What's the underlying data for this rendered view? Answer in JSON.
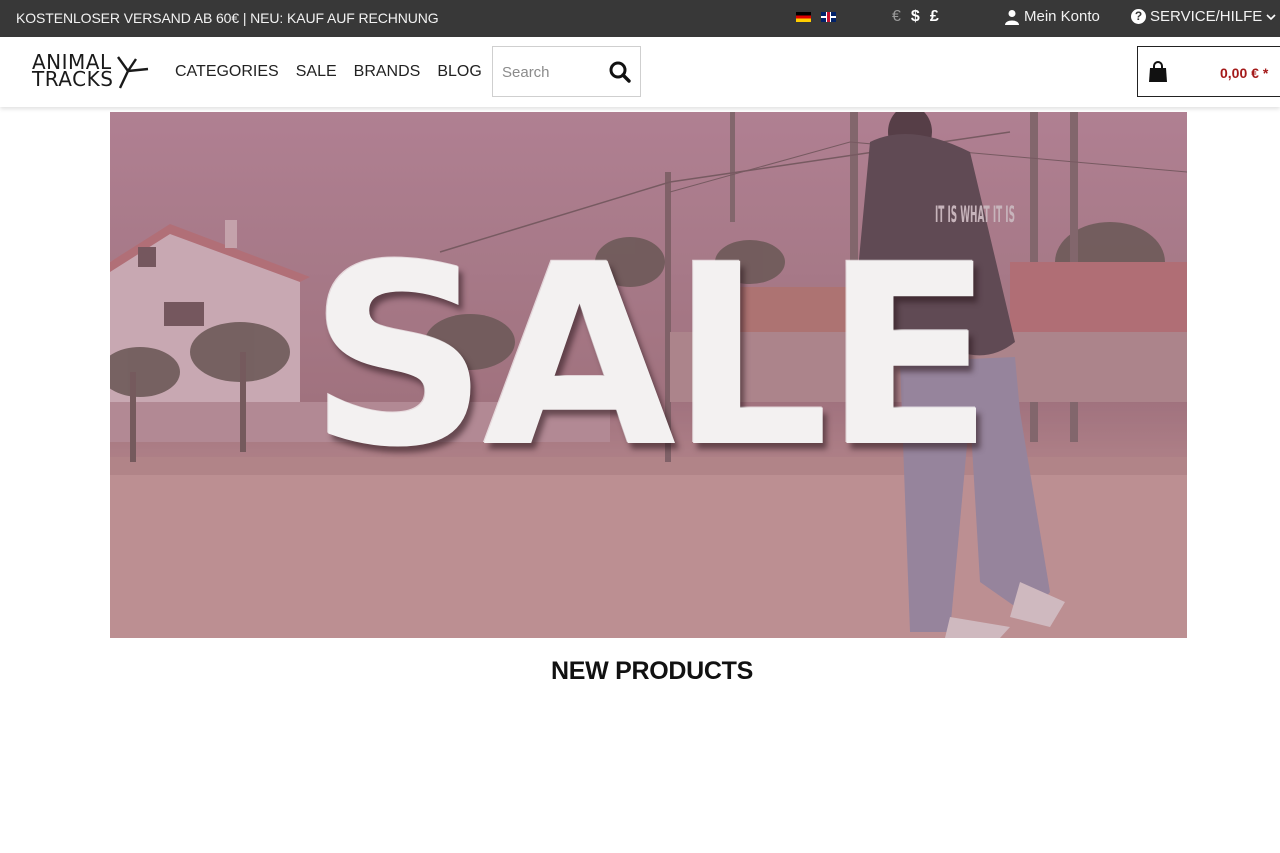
{
  "topbar": {
    "promo": "KOSTENLOSER VERSAND AB 60€ | NEU: KAUF AUF RECHNUNG",
    "languages": [
      "de-flag",
      "uk-flag"
    ],
    "currencies": [
      "€",
      "$",
      "£"
    ],
    "active_currency": "€",
    "account_label": "Mein Konto",
    "service_label": "SERVICE/HILFE",
    "background": "#383838"
  },
  "header": {
    "logo_line1": "ANIMAL",
    "logo_line2": "TRACKS",
    "nav": [
      "CATEGORIES",
      "SALE",
      "BRANDS",
      "BLOG"
    ],
    "search": {
      "placeholder": "Search",
      "value": ""
    },
    "cart": {
      "total": "0,00 € *",
      "total_color": "#a41a1a"
    }
  },
  "hero": {
    "headline": "SALE",
    "hoodie_print": "IT IS WHAT IT IS",
    "tint": "#a9798a"
  },
  "main": {
    "section_title": "NEW PRODUCTS"
  }
}
